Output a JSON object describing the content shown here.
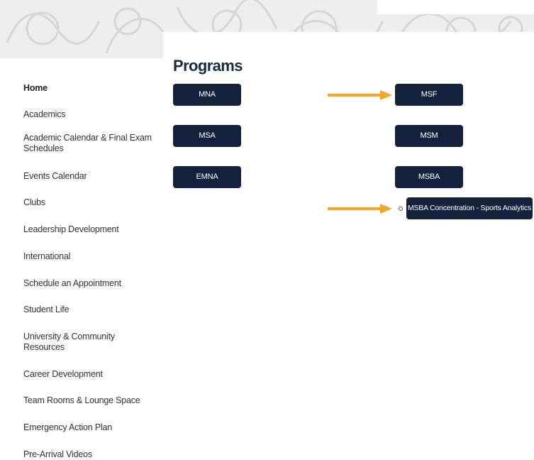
{
  "colors": {
    "button_bg": "#14213d",
    "button_text": "#ffffff",
    "arrow": "#f5a623",
    "title": "#1c2a40",
    "banner_bg": "#eeeeee"
  },
  "programs": {
    "title": "Programs",
    "buttons": {
      "mna": "MNA",
      "msa": "MSA",
      "emna": "EMNA",
      "msf": "MSF",
      "msm": "MSM",
      "msba": "MSBA",
      "msba_sports": "MSBA Concentration - Sports Analytics"
    }
  },
  "sidebar": {
    "items": [
      {
        "label": "Home"
      },
      {
        "label": "Academics"
      },
      {
        "label": "Academic Calendar & Final Exam Schedules"
      },
      {
        "label": "Events Calendar"
      },
      {
        "label": "Clubs"
      },
      {
        "label": "Leadership Development"
      },
      {
        "label": "International"
      },
      {
        "label": "Schedule an Appointment"
      },
      {
        "label": "Student Life"
      },
      {
        "label": "University & Community Resources"
      },
      {
        "label": "Career Development"
      },
      {
        "label": "Team Rooms & Lounge Space"
      },
      {
        "label": "Emergency Action Plan"
      },
      {
        "label": "Pre-Arrival Videos"
      }
    ]
  }
}
